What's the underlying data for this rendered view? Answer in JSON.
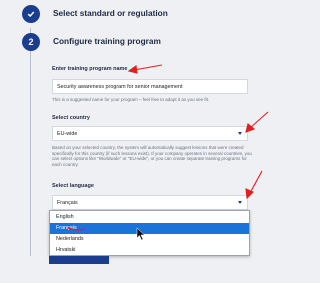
{
  "steps": [
    {
      "number": "",
      "title": "Select standard or regulation",
      "done": true
    },
    {
      "number": "2",
      "title": "Configure training program",
      "done": false
    }
  ],
  "form": {
    "program_name": {
      "label": "Enter training program name",
      "value": "Security awareness program for senior management",
      "hint": "This is a suggested name for your program – feel free to adapt it as you see fit."
    },
    "country": {
      "label": "Select country",
      "value": "EU-wide",
      "hint": "Based on your selected country, the system will automatically suggest lessons that were created specifically for this country (if such lessons exist). If your company operates in several countries, you can select options like \"Worldwide\" or \"EU-wide\", or you can create separate training programs for each country."
    },
    "language": {
      "label": "Select language",
      "value": "Français",
      "options": [
        "English",
        "Français",
        "Nederlands",
        "Hrvatski"
      ],
      "highlighted_index": 1
    }
  },
  "colors": {
    "accent": "#1a3d8f",
    "highlight": "#1a73d9",
    "annotation": "#e02020"
  }
}
